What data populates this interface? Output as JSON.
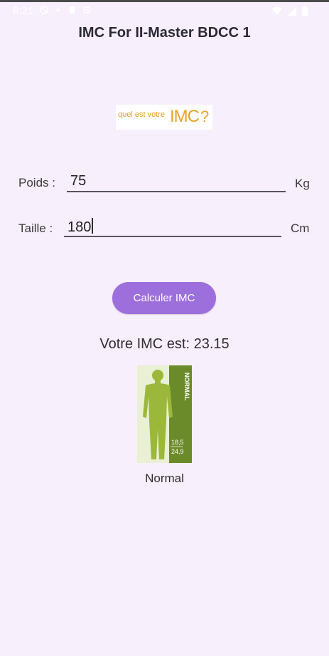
{
  "status_bar": {
    "time": "8:21"
  },
  "app": {
    "title": "IMC For II-Master BDCC 1"
  },
  "banner": {
    "text_small": "quel est votre",
    "text_big": "IMC",
    "text_q": "?"
  },
  "form": {
    "poids_label": "Poids :",
    "poids_value": "75",
    "poids_unit": "Kg",
    "taille_label": "Taille :",
    "taille_value": "180",
    "taille_unit": "Cm"
  },
  "button": {
    "label": "Calculer IMC"
  },
  "result": {
    "text": "Votre IMC est: 23.15"
  },
  "figure": {
    "category_vertical": "NORMAL",
    "range_low": "18,5",
    "range_high": "24,9",
    "body_color": "#9bb83a",
    "panel_color": "#6b8a2a"
  },
  "category": {
    "label": "Normal"
  },
  "colors": {
    "background": "#f8effd",
    "accent": "#9c6fdd"
  }
}
